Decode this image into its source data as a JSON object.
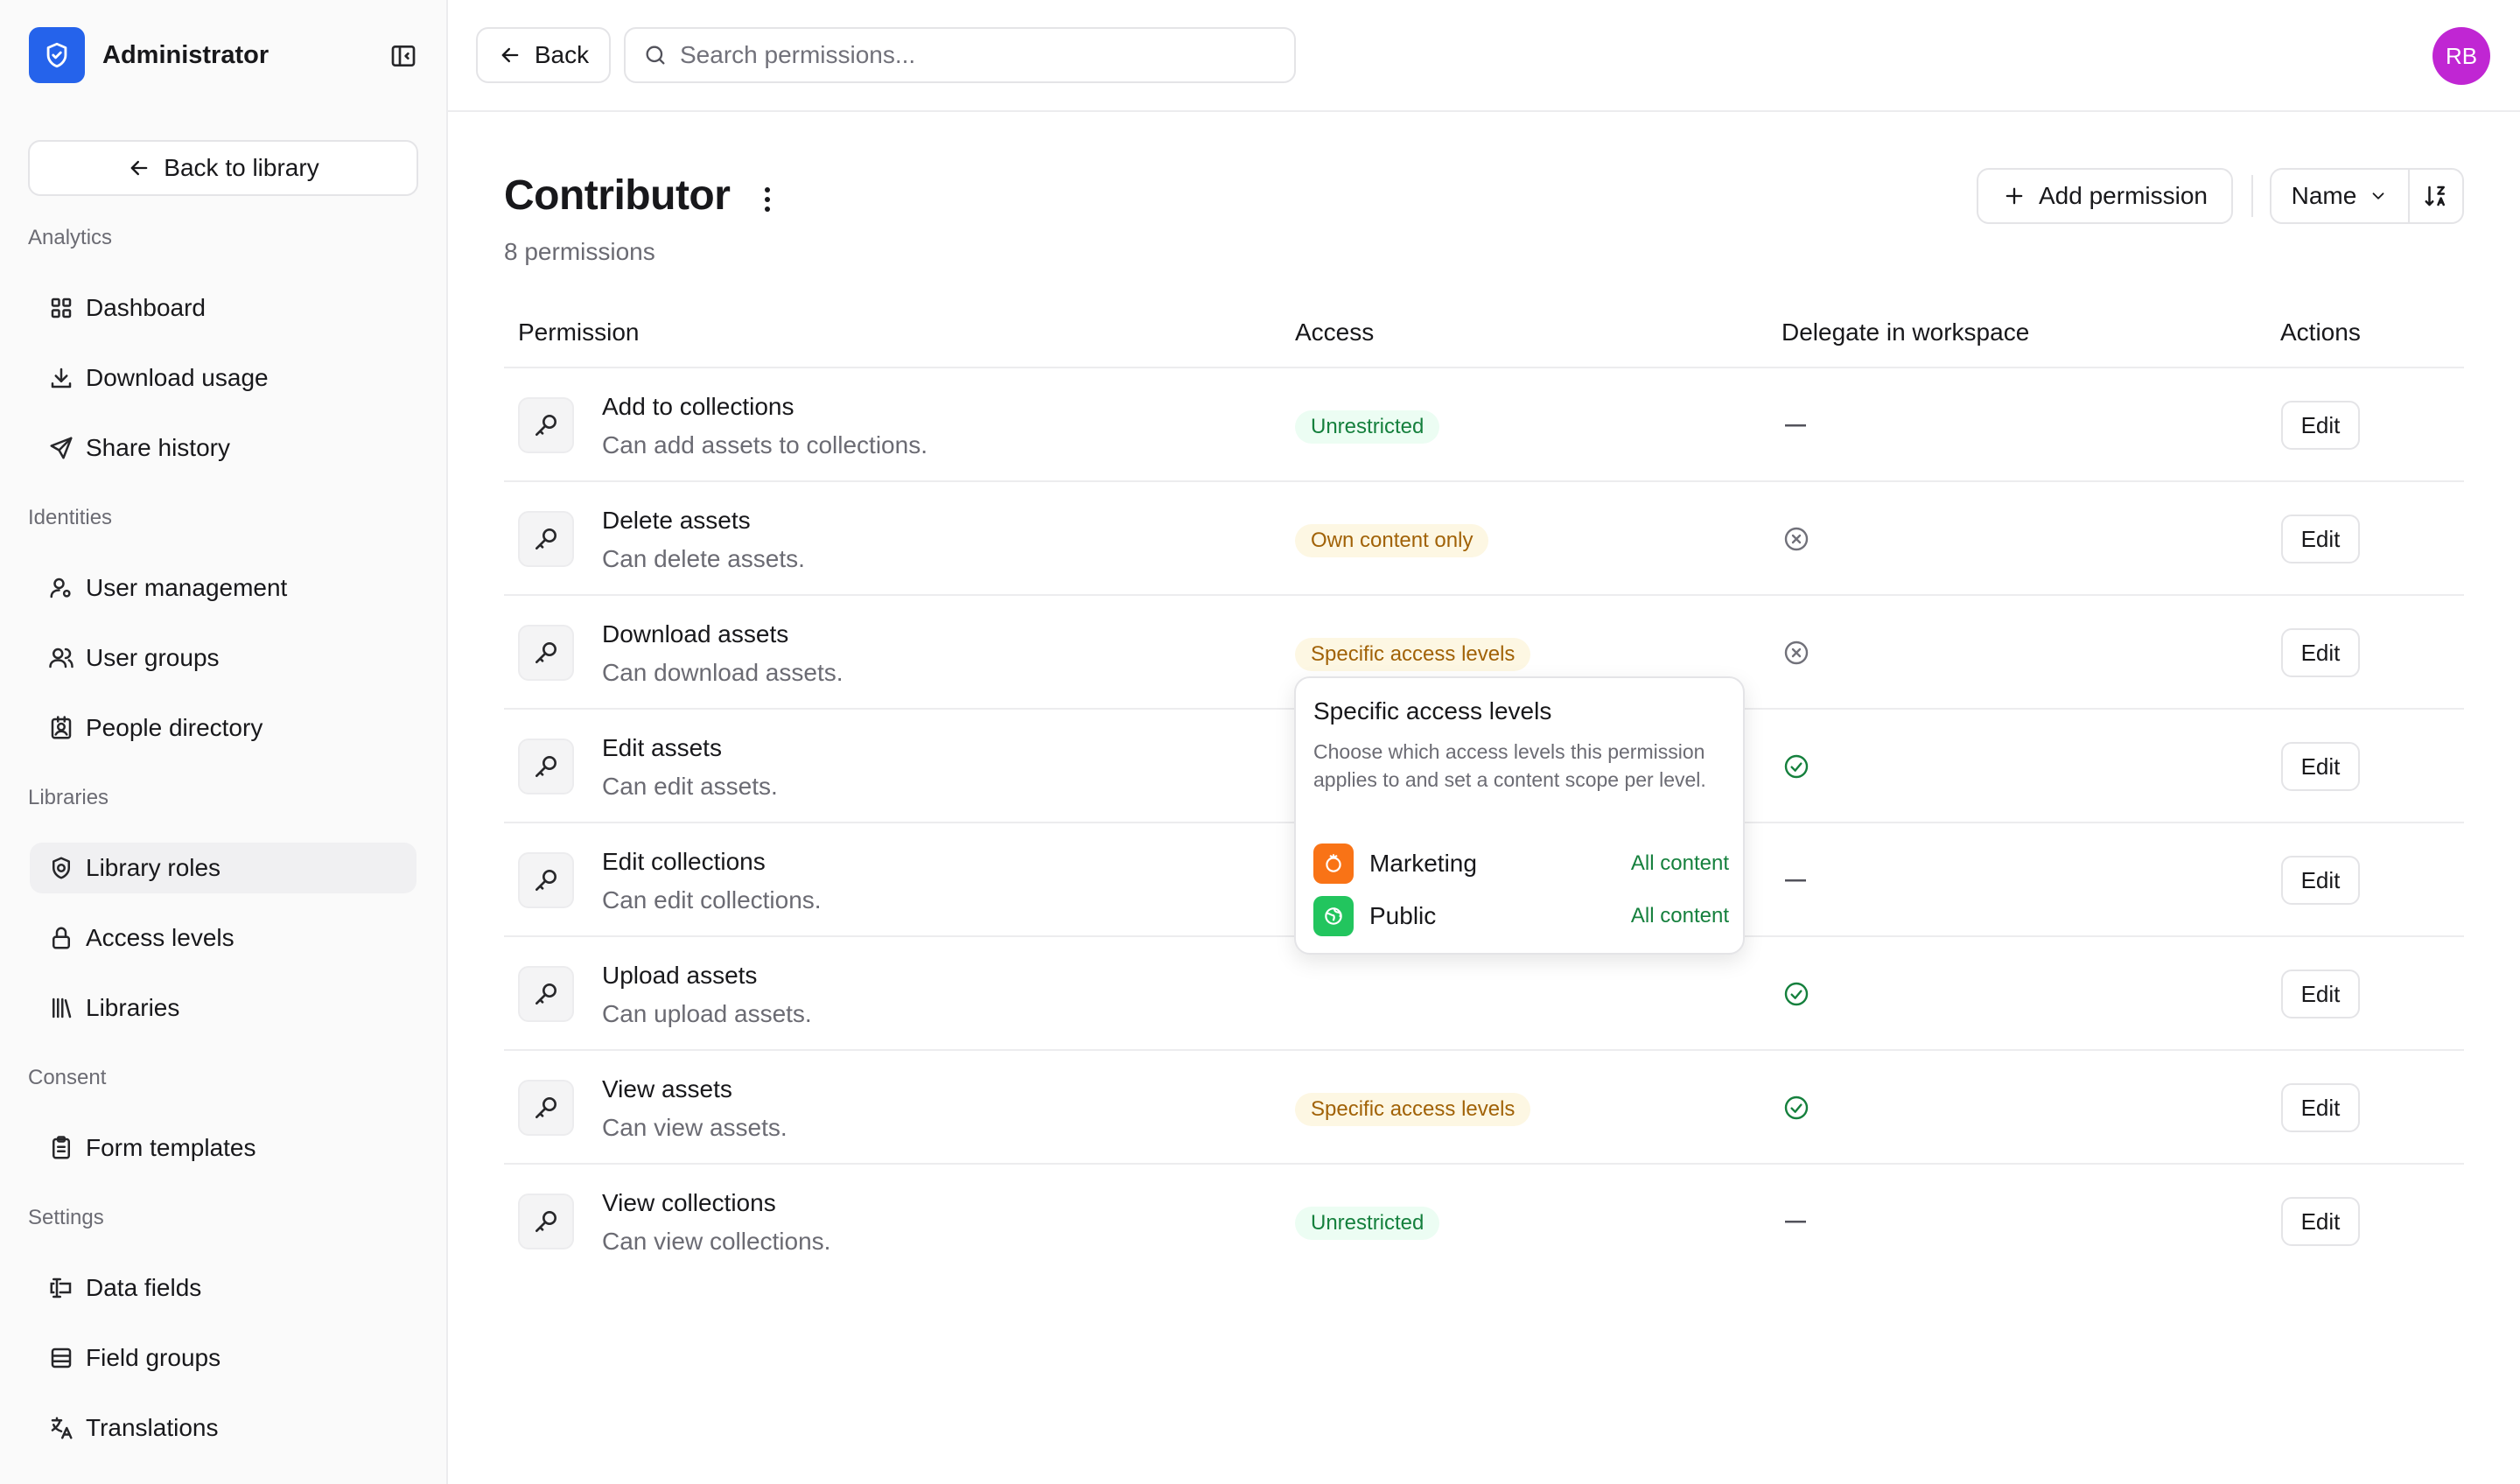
{
  "app": {
    "name": "Administrator"
  },
  "sidebar": {
    "back_label": "Back to library",
    "sections": [
      {
        "title": "Analytics",
        "items": [
          {
            "label": "Dashboard",
            "icon": "dashboard-icon"
          },
          {
            "label": "Download usage",
            "icon": "download-icon"
          },
          {
            "label": "Share history",
            "icon": "send-icon"
          }
        ]
      },
      {
        "title": "Identities",
        "items": [
          {
            "label": "User management",
            "icon": "user-cog-icon"
          },
          {
            "label": "User groups",
            "icon": "users-icon"
          },
          {
            "label": "People directory",
            "icon": "contact-icon"
          }
        ]
      },
      {
        "title": "Libraries",
        "items": [
          {
            "label": "Library roles",
            "icon": "shield-cog-icon",
            "active": true
          },
          {
            "label": "Access levels",
            "icon": "lock-icon"
          },
          {
            "label": "Libraries",
            "icon": "library-icon"
          }
        ]
      },
      {
        "title": "Consent",
        "items": [
          {
            "label": "Form templates",
            "icon": "clipboard-icon"
          }
        ]
      },
      {
        "title": "Settings",
        "items": [
          {
            "label": "Data fields",
            "icon": "text-field-icon"
          },
          {
            "label": "Field groups",
            "icon": "table-icon"
          },
          {
            "label": "Translations",
            "icon": "languages-icon"
          }
        ]
      }
    ]
  },
  "header": {
    "back_label": "Back",
    "search_placeholder": "Search permissions...",
    "avatar_initials": "RB"
  },
  "page": {
    "title": "Contributor",
    "subtitle": "8 permissions",
    "add_label": "Add permission",
    "sort_label": "Name"
  },
  "table": {
    "columns": [
      "Permission",
      "Access",
      "Delegate in workspace",
      "Actions"
    ],
    "edit_label": "Edit",
    "rows": [
      {
        "name": "Add to collections",
        "description": "Can add assets to collections.",
        "access": "Unrestricted",
        "access_tone": "green",
        "delegate": "none"
      },
      {
        "name": "Delete assets",
        "description": "Can delete assets.",
        "access": "Own content only",
        "access_tone": "amber",
        "delegate": "no"
      },
      {
        "name": "Download assets",
        "description": "Can download assets.",
        "access": "Specific access levels",
        "access_tone": "amber",
        "delegate": "no"
      },
      {
        "name": "Edit assets",
        "description": "Can edit assets.",
        "access": "",
        "access_tone": "",
        "delegate": "yes"
      },
      {
        "name": "Edit collections",
        "description": "Can edit collections.",
        "access": "",
        "access_tone": "",
        "delegate": "none"
      },
      {
        "name": "Upload assets",
        "description": "Can upload assets.",
        "access": "",
        "access_tone": "",
        "delegate": "yes"
      },
      {
        "name": "View assets",
        "description": "Can view assets.",
        "access": "Specific access levels",
        "access_tone": "amber",
        "delegate": "yes"
      },
      {
        "name": "View collections",
        "description": "Can view collections.",
        "access": "Unrestricted",
        "access_tone": "green",
        "delegate": "none"
      }
    ]
  },
  "popover": {
    "title": "Specific access levels",
    "body": "Choose which access levels this permission applies to and set a content scope per level.",
    "levels": [
      {
        "name": "Marketing",
        "scope": "All content",
        "color": "#f97316"
      },
      {
        "name": "Public",
        "scope": "All content",
        "color": "#22c55e"
      }
    ]
  },
  "colors": {
    "brand": "#2563eb",
    "avatar": "#c026d3",
    "success": "#15803d",
    "warning": "#a16207"
  }
}
